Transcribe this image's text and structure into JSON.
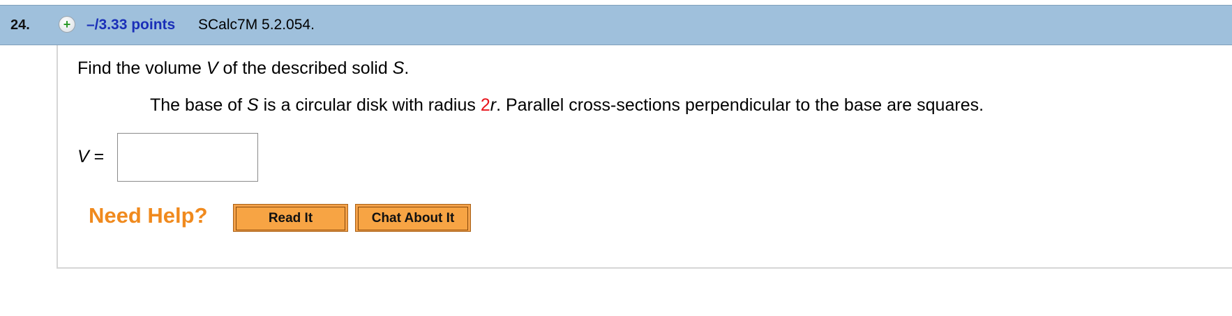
{
  "question": {
    "number": "24.",
    "points": "–/3.33 points",
    "source": "SCalc7M 5.2.054."
  },
  "prompt": {
    "before": "Find the volume ",
    "var_v": "V",
    "middle": " of the described solid ",
    "var_s": "S",
    "after": "."
  },
  "given": {
    "part1": "The base of ",
    "var_s": "S",
    "part2": " is a circular disk with radius ",
    "radius_value": "2",
    "var_r": "r",
    "part3": ". Parallel cross-sections perpendicular to the base are squares."
  },
  "answer": {
    "var_v": "V",
    "equals": " =",
    "value": ""
  },
  "help": {
    "title": "Need Help?",
    "read_it": "Read It",
    "chat_about_it": "Chat About It"
  },
  "colors": {
    "header_bg": "#9fc0dc",
    "points_blue": "#1a2fb8",
    "help_orange": "#f08a1e",
    "highlight_red": "#e8141c",
    "button_orange": "#f7a444"
  },
  "icons": {
    "expand": "plus-icon"
  }
}
